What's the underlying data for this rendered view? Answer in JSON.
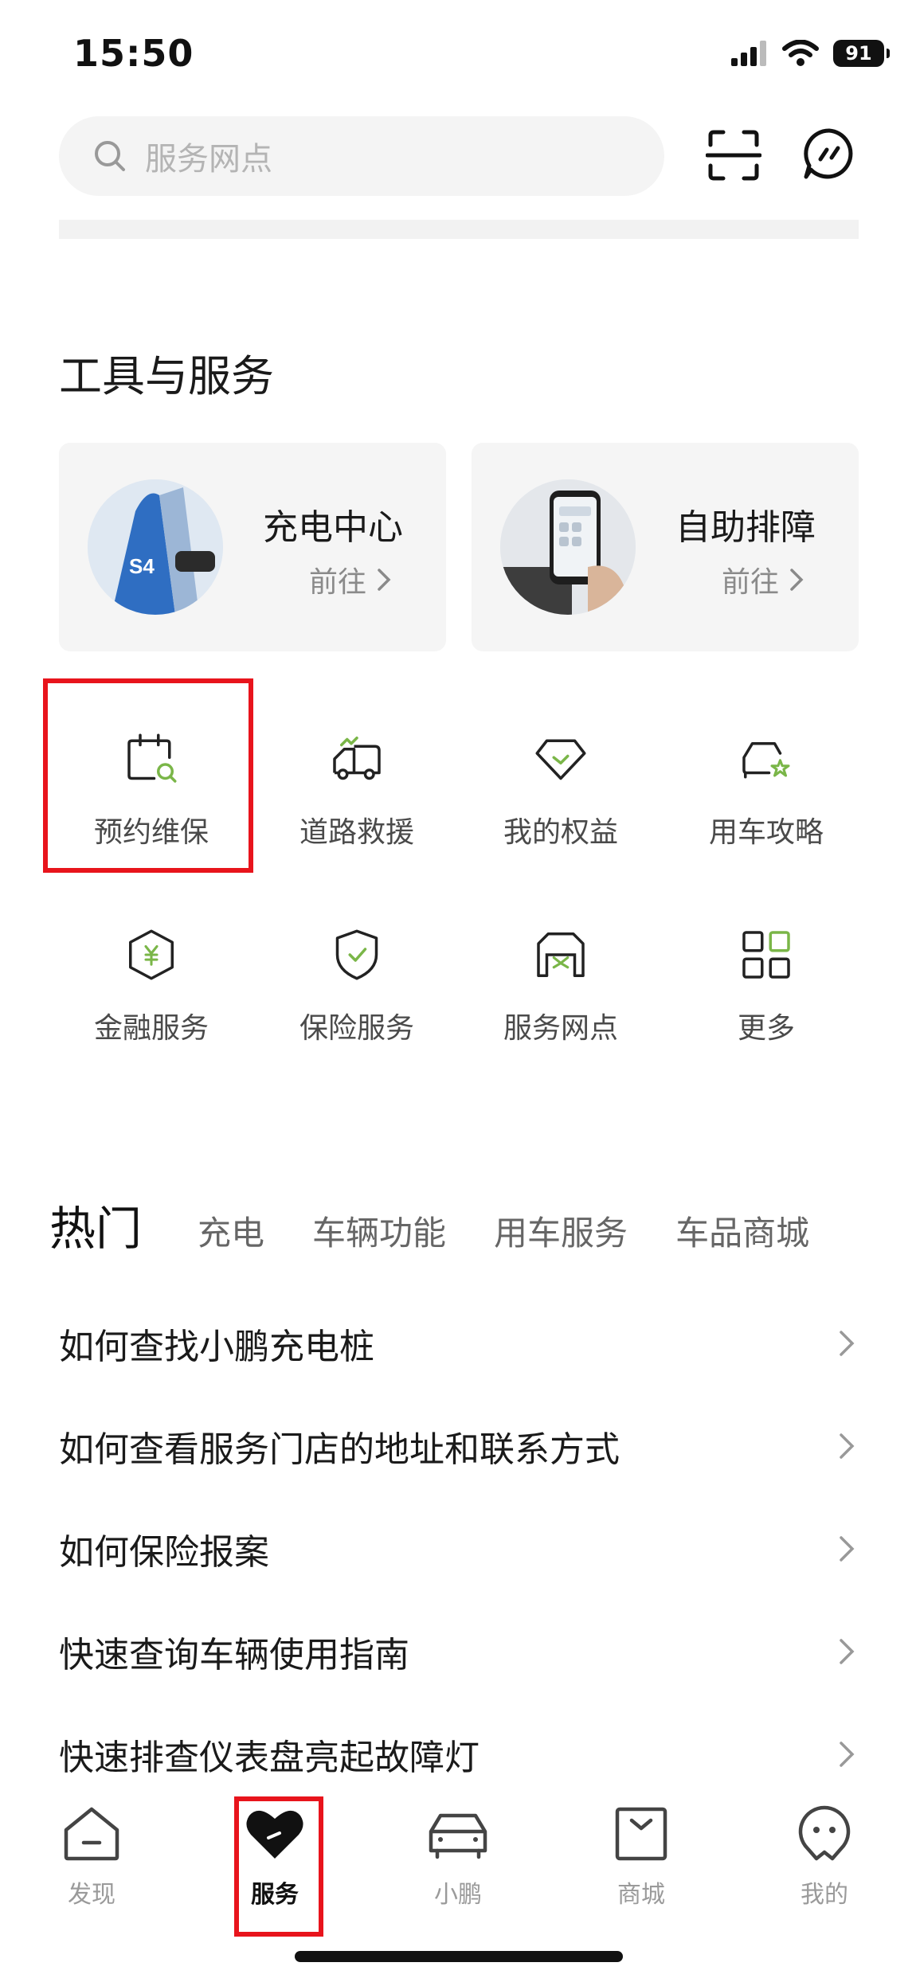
{
  "status_bar": {
    "time": "15:50",
    "battery": "91"
  },
  "search": {
    "placeholder": "服务网点"
  },
  "tools": {
    "title": "工具与服务",
    "cards": [
      {
        "title": "充电中心",
        "go": "前往"
      },
      {
        "title": "自助排障",
        "go": "前往"
      }
    ],
    "grid": [
      {
        "label": "预约维保",
        "icon": "calendar-wrench-icon"
      },
      {
        "label": "道路救援",
        "icon": "tow-truck-icon"
      },
      {
        "label": "我的权益",
        "icon": "diamond-check-icon"
      },
      {
        "label": "用车攻略",
        "icon": "car-star-icon"
      },
      {
        "label": "金融服务",
        "icon": "hexagon-yen-icon"
      },
      {
        "label": "保险服务",
        "icon": "shield-check-icon"
      },
      {
        "label": "服务网点",
        "icon": "service-store-icon"
      },
      {
        "label": "更多",
        "icon": "grid-more-icon"
      }
    ]
  },
  "hot": {
    "tabs": [
      "热门",
      "充电",
      "车辆功能",
      "用车服务",
      "车品商城"
    ],
    "faqs": [
      "如何查找小鹏充电桩",
      "如何查看服务门店的地址和联系方式",
      "如何保险报案",
      "快速查询车辆使用指南",
      "快速排查仪表盘亮起故障灯"
    ]
  },
  "nav": {
    "items": [
      {
        "label": "发现",
        "icon": "home-icon"
      },
      {
        "label": "服务",
        "icon": "heart-icon"
      },
      {
        "label": "小鹏",
        "icon": "car-icon"
      },
      {
        "label": "商城",
        "icon": "shopping-bag-icon"
      },
      {
        "label": "我的",
        "icon": "profile-face-icon"
      }
    ],
    "active_index": 1
  },
  "colors": {
    "accent_green": "#7ab648",
    "highlight_red": "#e8141c"
  }
}
